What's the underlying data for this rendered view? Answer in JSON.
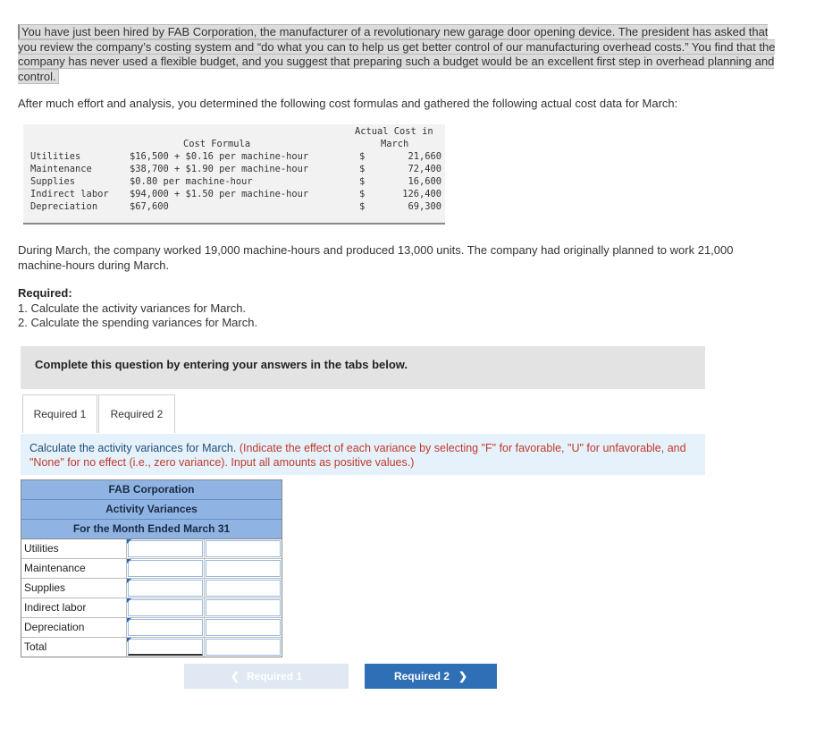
{
  "intro": {
    "text": "You have just been hired by FAB Corporation, the manufacturer of a revolutionary new garage door opening device. The president has asked that you review the company’s costing system and “do what you can to help us get better control of our manufacturing overhead costs.” You find that the company has never used a flexible budget, and you suggest that preparing such a budget would be an excellent first step in overhead planning and control."
  },
  "after_text": "After much effort and analysis, you determined the following cost formulas and gathered the following actual cost data for March:",
  "cost_table": {
    "header_formula": "Cost Formula",
    "header_actual_line1": "Actual Cost in",
    "header_actual_line2": "March",
    "rows": [
      {
        "name": "Utilities",
        "formula": "$16,500 + $0.16 per machine-hour",
        "dollar": "$",
        "actual": "21,660"
      },
      {
        "name": "Maintenance",
        "formula": "$38,700 + $1.90 per machine-hour",
        "dollar": "$",
        "actual": "72,400"
      },
      {
        "name": "Supplies",
        "formula": "$0.80 per machine-hour",
        "dollar": "$",
        "actual": "16,600"
      },
      {
        "name": "Indirect labor",
        "formula": "$94,000 + $1.50 per machine-hour",
        "dollar": "$",
        "actual": "126,400"
      },
      {
        "name": "Depreciation",
        "formula": "$67,600",
        "dollar": "$",
        "actual": "69,300"
      }
    ]
  },
  "march_text": "During March, the company worked 19,000 machine-hours and produced 13,000 units. The company had originally planned to work 21,000 machine-hours during March.",
  "required": {
    "title": "Required:",
    "items": [
      "1. Calculate the activity variances for March.",
      "2. Calculate the spending variances for March."
    ]
  },
  "banner_text": "Complete this question by entering your answers in the tabs below.",
  "tabs": [
    {
      "label": "Required 1",
      "active": true
    },
    {
      "label": "Required 2",
      "active": false
    }
  ],
  "instruction": {
    "text": "Calculate the activity variances for March.",
    "note": "(Indicate the effect of each variance by selecting \"F\" for favorable, \"U\" for unfavorable, and \"None\" for no effect (i.e., zero variance). Input all amounts as positive values.)"
  },
  "variance_table": {
    "title1": "FAB Corporation",
    "title2": "Activity Variances",
    "title3": "For the Month Ended March 31",
    "rows": [
      {
        "label": "Utilities"
      },
      {
        "label": "Maintenance"
      },
      {
        "label": "Supplies"
      },
      {
        "label": "Indirect labor"
      },
      {
        "label": "Depreciation"
      },
      {
        "label": "Total"
      }
    ]
  },
  "nav": {
    "prev_label": "Required 1",
    "next_label": "Required 2",
    "prev_color": "#dfe8f3",
    "next_color": "#2f6fb5"
  }
}
